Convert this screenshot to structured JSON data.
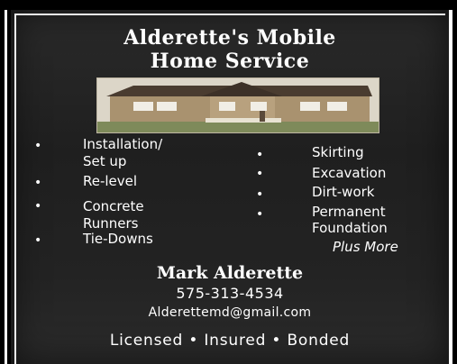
{
  "title_line1": "Alderette's Mobile",
  "title_line2": "Home Service",
  "services_left": [
    {
      "line1": "Installation/",
      "line2": "Set up"
    },
    {
      "line1": "Re-level",
      "line2": ""
    },
    {
      "line1": "Concrete",
      "line2": "Runners"
    },
    {
      "line1": "Tie-Downs",
      "line2": ""
    }
  ],
  "services_right": [
    {
      "line1": "Skirting",
      "line2": ""
    },
    {
      "line1": "Excavation",
      "line2": ""
    },
    {
      "line1": "Dirt-work",
      "line2": ""
    },
    {
      "line1": "Permanent",
      "line2": "Foundation"
    }
  ],
  "plus_more": "Plus More",
  "contact_name": "Mark Alderette",
  "phone": "575-313-4534",
  "email": "Alderettemd@gmail.com",
  "tagline": "Licensed • Insured • Bonded",
  "bullet_glyph": "•",
  "colors": {
    "card_background": "#222222",
    "text": "#ffffff"
  }
}
